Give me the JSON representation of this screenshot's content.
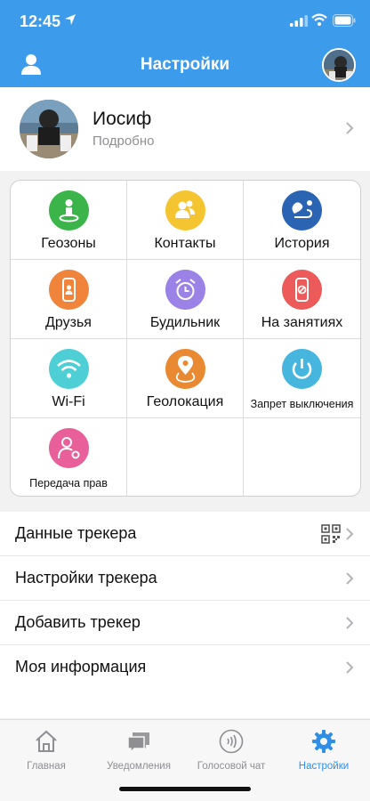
{
  "status_bar": {
    "time": "12:45"
  },
  "header": {
    "title": "Настройки"
  },
  "profile": {
    "name": "Иосиф",
    "subtitle": "Подробно"
  },
  "grid": {
    "items": [
      {
        "label": "Геозоны",
        "icon": "geofence-icon",
        "color": "#3bb44a"
      },
      {
        "label": "Контакты",
        "icon": "contacts-icon",
        "color": "#f5c531"
      },
      {
        "label": "История",
        "icon": "history-route-icon",
        "color": "#2c64b4"
      },
      {
        "label": "Друзья",
        "icon": "friends-watch-icon",
        "color": "#f0843a"
      },
      {
        "label": "Будильник",
        "icon": "alarm-clock-icon",
        "color": "#9b82e6"
      },
      {
        "label": "На занятиях",
        "icon": "class-mode-icon",
        "color": "#ec5a5a"
      },
      {
        "label": "Wi-Fi",
        "icon": "wifi-icon",
        "color": "#4ecfd6"
      },
      {
        "label": "Геолокация",
        "icon": "geolocation-icon",
        "color": "#e98a32"
      },
      {
        "label": "Запрет выключения",
        "icon": "power-lock-icon",
        "color": "#46b6de"
      },
      {
        "label": "Передача прав",
        "icon": "transfer-rights-icon",
        "color": "#e95f9a"
      }
    ]
  },
  "settings_list": [
    {
      "label": "Данные трекера",
      "has_qr": true
    },
    {
      "label": "Настройки трекера",
      "has_qr": false
    },
    {
      "label": "Добавить трекер",
      "has_qr": false
    },
    {
      "label": "Моя информация",
      "has_qr": false
    }
  ],
  "tabbar": {
    "tabs": [
      {
        "label": "Главная",
        "icon": "home-icon",
        "active": false
      },
      {
        "label": "Уведомления",
        "icon": "notifications-chat-icon",
        "active": false
      },
      {
        "label": "Голосовой чат",
        "icon": "voice-chat-icon",
        "active": false
      },
      {
        "label": "Настройки",
        "icon": "gear-icon",
        "active": true
      }
    ]
  },
  "colors": {
    "primary": "#3d9bec",
    "tab_active": "#2f8fe6"
  }
}
